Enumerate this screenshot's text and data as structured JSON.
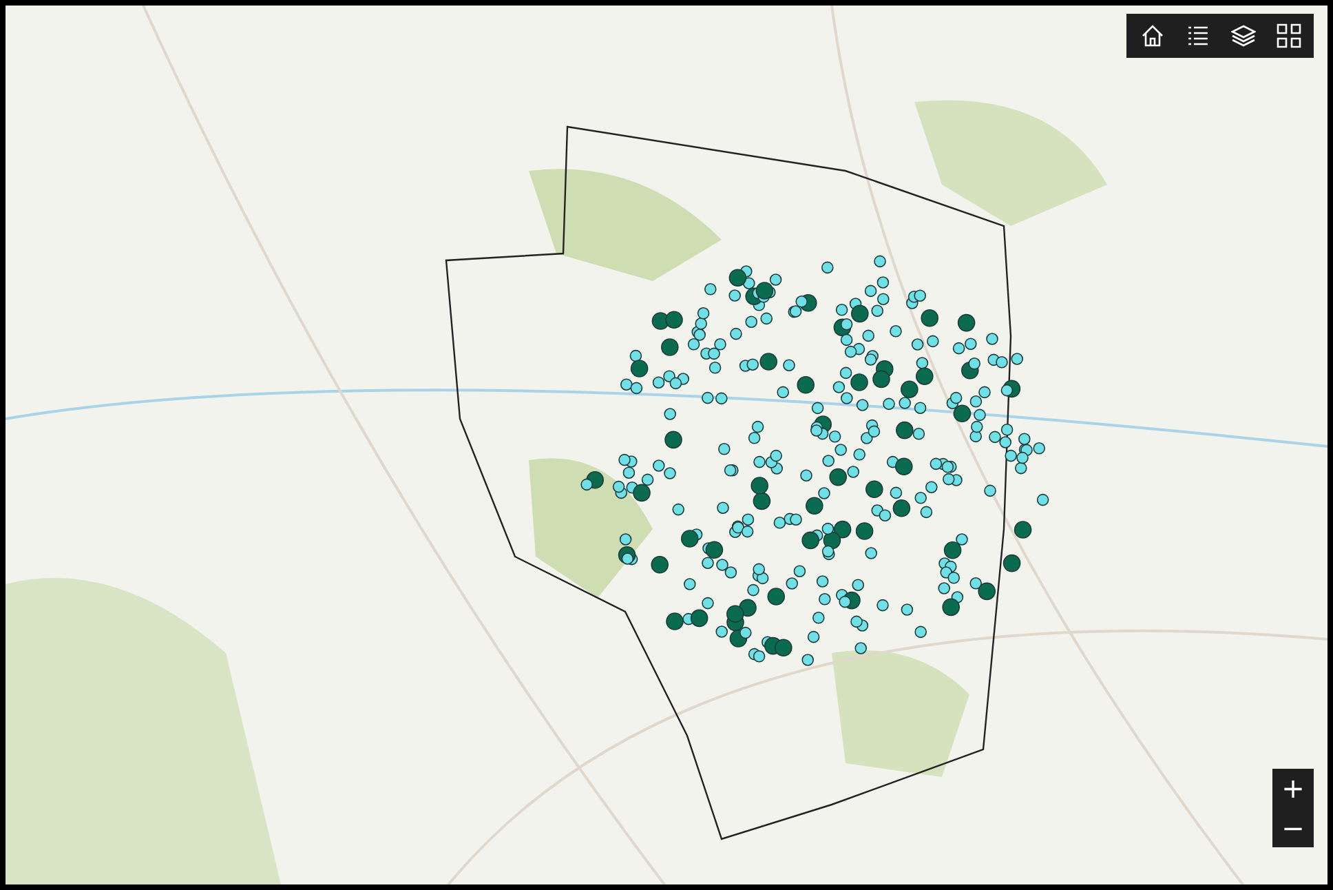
{
  "toolbar": {
    "buttons": [
      {
        "kind": "home"
      },
      {
        "kind": "list"
      },
      {
        "kind": "layers"
      },
      {
        "kind": "gallery"
      }
    ]
  },
  "zoom": {
    "zoom_in": "+",
    "zoom_out": "−"
  }
}
